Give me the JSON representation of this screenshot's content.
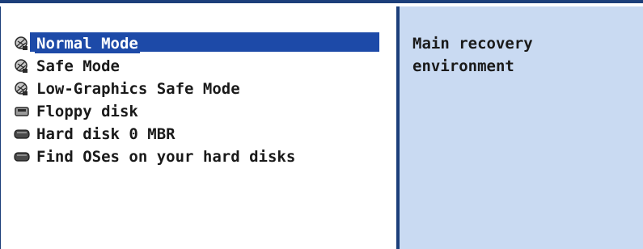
{
  "menu": {
    "items": [
      {
        "label": "Normal Mode",
        "icon": "recovery-icon",
        "selected": true
      },
      {
        "label": "Safe Mode",
        "icon": "recovery-icon",
        "selected": false
      },
      {
        "label": "Low-Graphics Safe Mode",
        "icon": "recovery-icon",
        "selected": false
      },
      {
        "label": "Floppy disk",
        "icon": "floppy-disk-icon",
        "selected": false
      },
      {
        "label": "Hard disk 0 MBR",
        "icon": "hard-disk-icon",
        "selected": false
      },
      {
        "label": "Find OSes on your hard disks",
        "icon": "hard-disk-icon",
        "selected": false
      }
    ]
  },
  "description": {
    "text": "Main recovery\nenvironment"
  },
  "colors": {
    "border": "#1c3f7a",
    "selection": "#1d4aa8",
    "description_bg": "#c9daf2"
  }
}
